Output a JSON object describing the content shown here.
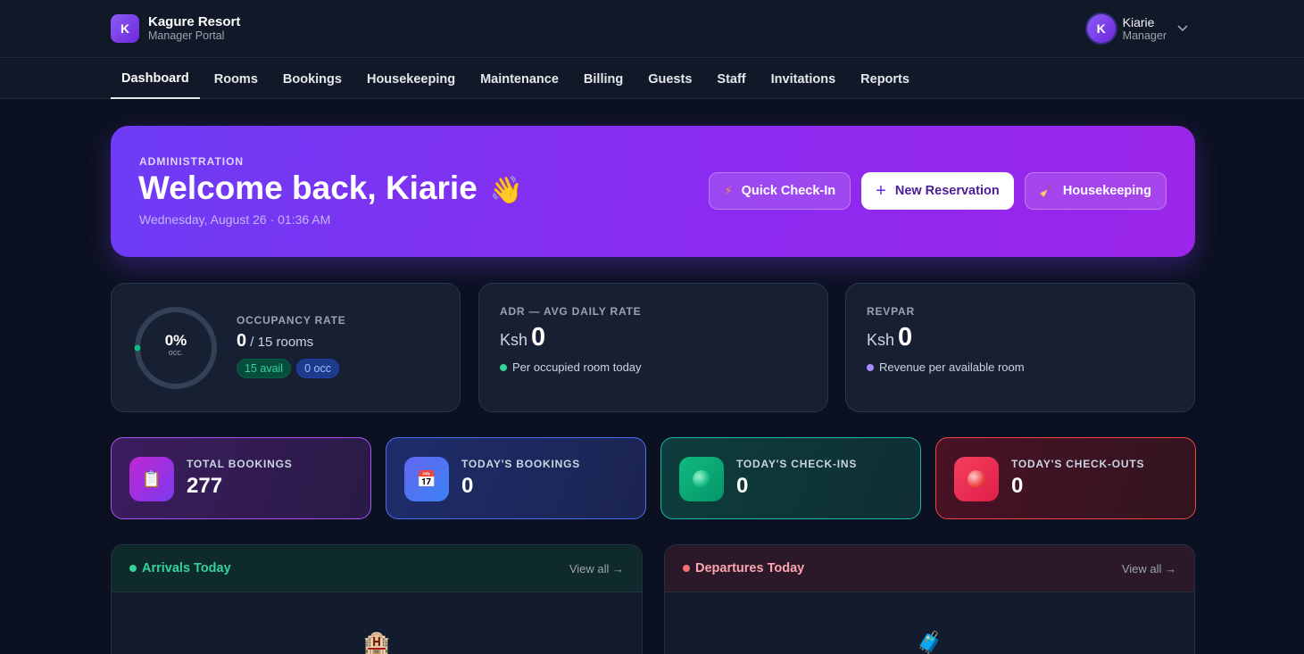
{
  "brand": {
    "logo_letter": "K",
    "name": "Kagure Resort",
    "subtitle": "Manager Portal"
  },
  "user": {
    "initial": "K",
    "name": "Kiarie",
    "role": "Manager",
    "menu_icon": "chevron-down-icon"
  },
  "nav": {
    "tabs": [
      {
        "label": "Dashboard",
        "active": true
      },
      {
        "label": "Rooms"
      },
      {
        "label": "Bookings"
      },
      {
        "label": "Housekeeping"
      },
      {
        "label": "Maintenance"
      },
      {
        "label": "Billing"
      },
      {
        "label": "Guests"
      },
      {
        "label": "Staff"
      },
      {
        "label": "Invitations"
      },
      {
        "label": "Reports"
      }
    ]
  },
  "hero": {
    "eyebrow": "ADMINISTRATION",
    "title": "Welcome back, Kiarie",
    "wave": "👋",
    "date": "Wednesday, August 26 · 01:36 AM",
    "actions": {
      "quick_checkin": "Quick Check-In",
      "new_reservation": "New Reservation",
      "housekeeping": "Housekeeping"
    },
    "icons": {
      "bolt": "⚡",
      "plus": "+",
      "broom": "🧹"
    }
  },
  "occupancy": {
    "percent": "0%",
    "percent_sub": "occ.",
    "percent_value": 0,
    "label": "OCCUPANCY RATE",
    "occupied": "0",
    "total_text": "/ 15 rooms",
    "avail_pill": "15 avail",
    "occ_pill": "0 occ"
  },
  "adr": {
    "label": "ADR — AVG DAILY RATE",
    "currency": "Ksh",
    "value": "0",
    "note": "Per occupied room today"
  },
  "revpar": {
    "label": "REVPAR",
    "currency": "Ksh",
    "value": "0",
    "note": "Revenue per available room"
  },
  "stats": [
    {
      "label": "TOTAL BOOKINGS",
      "value": "277",
      "icon": "📋"
    },
    {
      "label": "TODAY'S BOOKINGS",
      "value": "0",
      "icon": "📅"
    },
    {
      "label": "TODAY'S CHECK-INS",
      "value": "0",
      "icon": "green-circle-icon"
    },
    {
      "label": "TODAY'S CHECK-OUTS",
      "value": "0",
      "icon": "red-circle-icon"
    }
  ],
  "arrivals": {
    "title": "Arrivals Today",
    "view_all": "View all →",
    "icon": "🏨"
  },
  "departures": {
    "title": "Departures Today",
    "view_all": "View all →",
    "icon": "🧳"
  },
  "colors": {
    "accent": "#7c3aed",
    "bg": "#0b1120",
    "card": "#172033",
    "green": "#34d399",
    "red": "#ef4444"
  }
}
